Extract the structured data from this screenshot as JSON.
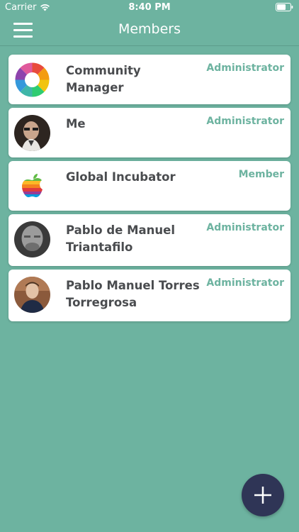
{
  "status_bar": {
    "carrier": "Carrier",
    "time": "8:40 PM"
  },
  "nav": {
    "title": "Members"
  },
  "members": [
    {
      "name": "Community Manager",
      "role": "Administrator"
    },
    {
      "name": "Me",
      "role": "Administrator"
    },
    {
      "name": "Global Incubator",
      "role": "Member"
    },
    {
      "name": "Pablo de Manuel Triantafilo",
      "role": "Administrator"
    },
    {
      "name": "Pablo Manuel Torres Torregrosa",
      "role": "Administrator"
    }
  ],
  "colors": {
    "background": "#6db3a0",
    "role_text": "#6db3a0",
    "name_text": "#4a4c4f",
    "fab": "#2f3556"
  },
  "icons": {
    "menu": "hamburger-menu-icon",
    "add": "plus-icon",
    "wifi": "wifi-icon",
    "battery": "battery-icon"
  }
}
